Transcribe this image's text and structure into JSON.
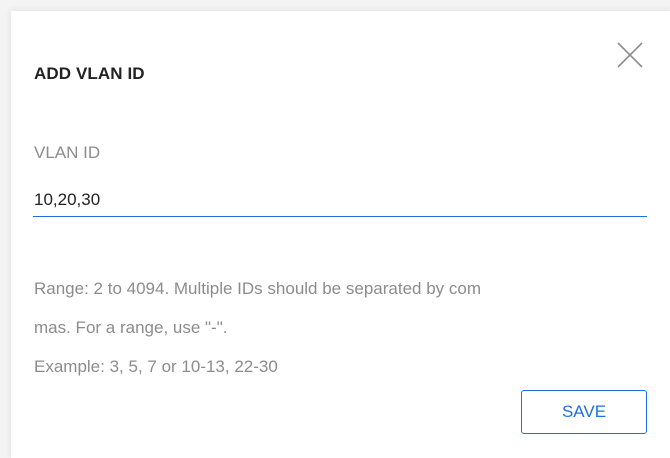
{
  "dialog": {
    "title": "ADD VLAN ID",
    "close_icon": "close-icon",
    "field": {
      "label": "VLAN ID",
      "value": "10,20,30",
      "placeholder": ""
    },
    "hint_lines": [
      "Range: 2 to 4094. Multiple IDs should be separated by com",
      "mas. For a range, use \"-\".",
      "Example: 3, 5, 7 or 10-13, 22-30"
    ],
    "save_label": "SAVE"
  },
  "colors": {
    "accent": "#1f6fe0",
    "title_text": "#222222",
    "muted_text": "#8c8c8c",
    "background": "#ffffff"
  }
}
